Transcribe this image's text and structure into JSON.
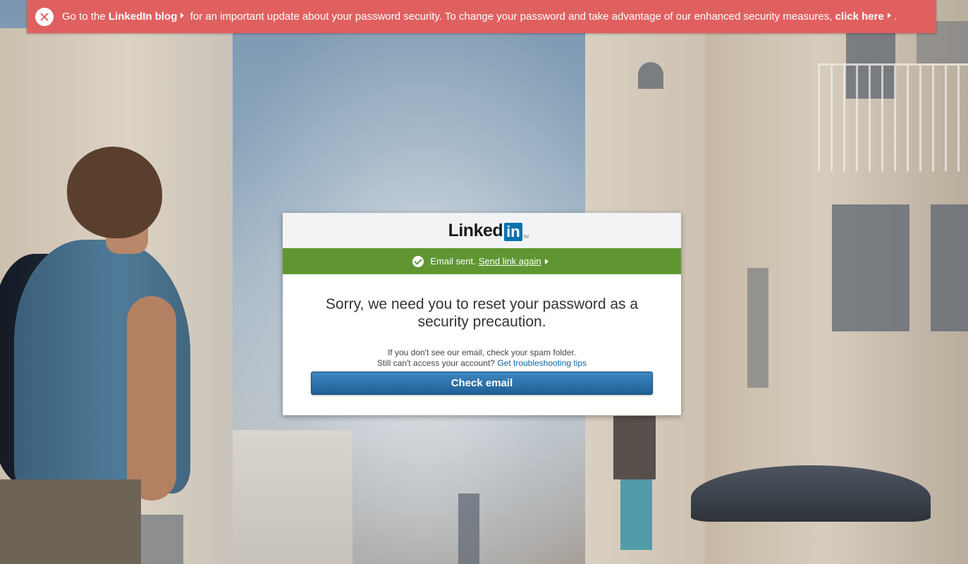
{
  "alert": {
    "prefix": "Go to the",
    "blog_link": "LinkedIn blog",
    "message": "for an important update about your password security. To change your password and take advantage of our enhanced security measures,",
    "click_link": "click here",
    "suffix": "."
  },
  "header": {
    "logo_text": "Linked",
    "logo_in": "in",
    "logo_tm": "TM"
  },
  "status": {
    "text": "Email sent.",
    "link": "Send link again"
  },
  "main": {
    "headline": "Sorry, we need you to reset your password as a security precaution.",
    "note_line1": "If you don't see our email, check your spam folder.",
    "note_line2": "Still can't access your account?",
    "troubleshoot_link": "Get troubleshooting tips",
    "button_label": "Check email"
  },
  "colors": {
    "alert_bg": "#e06060",
    "success_bg": "#5f9632",
    "linkedin_blue": "#0a72b1",
    "button_blue": "#1e5f96"
  },
  "icons": {
    "alert_close": "close-icon",
    "success": "check-circle-icon",
    "link_arrow": "caret-right-icon"
  }
}
